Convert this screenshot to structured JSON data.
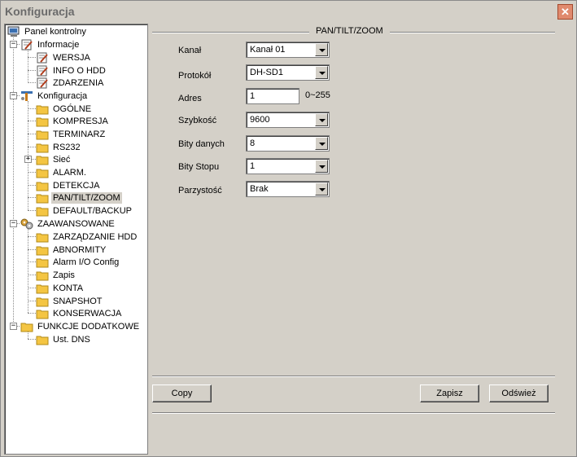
{
  "window": {
    "title": "Konfiguracja",
    "close_glyph": "✕"
  },
  "tree": {
    "root": "Panel kontrolny",
    "groups": [
      {
        "label": "Informacje",
        "expander": "−",
        "items": [
          "WERSJA",
          "INFO O HDD",
          "ZDARZENIA"
        ]
      },
      {
        "label": "Konfiguracja",
        "expander": "−",
        "items": [
          "OGÓLNE",
          "KOMPRESJA",
          "TERMINARZ",
          "RS232",
          "Sieć",
          "ALARM.",
          "DETEKCJA",
          "PAN/TILT/ZOOM",
          "DEFAULT/BACKUP"
        ]
      },
      {
        "label": "ZAAWANSOWANE",
        "expander": "−",
        "items": [
          "ZARZĄDZANIE HDD",
          "ABNORMITY",
          "Alarm I/O Config",
          "Zapis",
          "KONTA",
          "SNAPSHOT",
          "KONSERWACJA"
        ]
      },
      {
        "label": "FUNKCJE DODATKOWE",
        "expander": "−",
        "items": [
          "Ust. DNS"
        ]
      }
    ],
    "siec_expander": "+",
    "selected": "PAN/TILT/ZOOM"
  },
  "ptz": {
    "section_title": "PAN/TILT/ZOOM",
    "kanal": {
      "label": "Kanał",
      "value": "Kanał 01"
    },
    "protokol": {
      "label": "Protokół",
      "value": "DH-SD1"
    },
    "adres": {
      "label": "Adres",
      "value": "1",
      "range": "0~255"
    },
    "szybkosc": {
      "label": "Szybkość",
      "value": "9600"
    },
    "bity_danych": {
      "label": "Bity danych",
      "value": "8"
    },
    "bity_stopu": {
      "label": "Bity Stopu",
      "value": "1"
    },
    "parzystosc": {
      "label": "Parzystość",
      "value": "Brak"
    }
  },
  "buttons": {
    "copy": "Copy",
    "save": "Zapisz",
    "refresh": "Odśwież"
  },
  "colors": {
    "window_bg": "#d4d0c8",
    "folder": "#f4c542",
    "close": "#e08a6e"
  }
}
